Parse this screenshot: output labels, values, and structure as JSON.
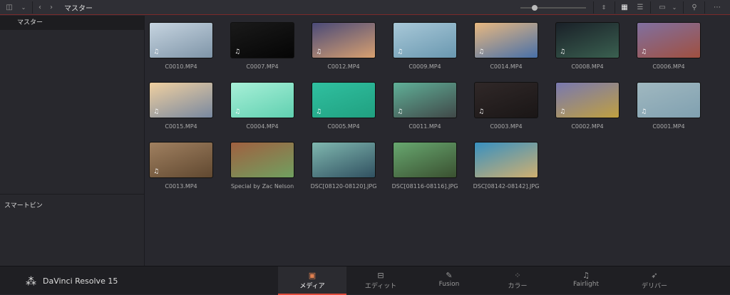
{
  "toolbar": {
    "title": "マスター",
    "icons": [
      "panel-toggle-icon",
      "chevron-down-icon",
      "back-icon",
      "forward-icon",
      "zoom-slider",
      "sort-icon",
      "grid-view-icon",
      "list-view-icon",
      "frame-icon",
      "search-icon",
      "more-icon"
    ],
    "slider_value": 0.22
  },
  "sidebar": {
    "master": "マスター",
    "smart_bins": "スマートビン"
  },
  "clips": [
    {
      "name": "C0010.MP4",
      "audio": true,
      "colors": [
        "#c6d4e0",
        "#7f95a8"
      ]
    },
    {
      "name": "C0007.MP4",
      "audio": true,
      "colors": [
        "#1a1a1a",
        "#050505"
      ]
    },
    {
      "name": "C0012.MP4",
      "audio": true,
      "colors": [
        "#4a4a78",
        "#d8a070"
      ]
    },
    {
      "name": "C0009.MP4",
      "audio": true,
      "colors": [
        "#a8c8d8",
        "#6a98b0"
      ]
    },
    {
      "name": "C0014.MP4",
      "audio": true,
      "colors": [
        "#e8b880",
        "#4870a8"
      ]
    },
    {
      "name": "C0008.MP4",
      "audio": true,
      "colors": [
        "#1a2028",
        "#3a6050"
      ]
    },
    {
      "name": "C0006.MP4",
      "audio": true,
      "colors": [
        "#8070a0",
        "#a05040"
      ]
    },
    {
      "name": "C0015.MP4",
      "audio": true,
      "colors": [
        "#f0d0a0",
        "#7888a0"
      ]
    },
    {
      "name": "C0004.MP4",
      "audio": true,
      "colors": [
        "#a8f0d8",
        "#60d0b0"
      ]
    },
    {
      "name": "C0005.MP4",
      "audio": true,
      "colors": [
        "#30c0a0",
        "#20a080"
      ]
    },
    {
      "name": "C0011.MP4",
      "audio": true,
      "colors": [
        "#60b098",
        "#404848"
      ]
    },
    {
      "name": "C0003.MP4",
      "audio": true,
      "colors": [
        "#302828",
        "#1a1616"
      ]
    },
    {
      "name": "C0002.MP4",
      "audio": true,
      "colors": [
        "#7878b0",
        "#c0a040"
      ]
    },
    {
      "name": "C0001.MP4",
      "audio": true,
      "colors": [
        "#a0b8c0",
        "#80a0b0"
      ]
    },
    {
      "name": "C0013.MP4",
      "audio": true,
      "colors": [
        "#a08060",
        "#604830"
      ]
    },
    {
      "name": "Special by Zac Nelson",
      "audio": false,
      "colors": [
        "#a06040",
        "#70a060"
      ]
    },
    {
      "name": "DSC[08120-08120].JPG",
      "audio": false,
      "colors": [
        "#80b8b0",
        "#305060"
      ]
    },
    {
      "name": "DSC[08116-08116].JPG",
      "audio": false,
      "colors": [
        "#68a870",
        "#3a5030"
      ]
    },
    {
      "name": "DSC[08142-08142].JPG",
      "audio": false,
      "colors": [
        "#3890c0",
        "#d0b070"
      ]
    }
  ],
  "app": {
    "name": "DaVinci Resolve 15"
  },
  "tabs": [
    {
      "label": "メディア",
      "icon": "media-icon",
      "glyph": "▣",
      "active": true
    },
    {
      "label": "エディット",
      "icon": "edit-icon",
      "glyph": "⊟",
      "active": false
    },
    {
      "label": "Fusion",
      "icon": "fusion-icon",
      "glyph": "✎",
      "active": false
    },
    {
      "label": "カラー",
      "icon": "color-icon",
      "glyph": "⁘",
      "active": false
    },
    {
      "label": "Fairlight",
      "icon": "fairlight-icon",
      "glyph": "♫",
      "active": false
    },
    {
      "label": "デリバー",
      "icon": "deliver-icon",
      "glyph": "➶",
      "active": false
    }
  ]
}
